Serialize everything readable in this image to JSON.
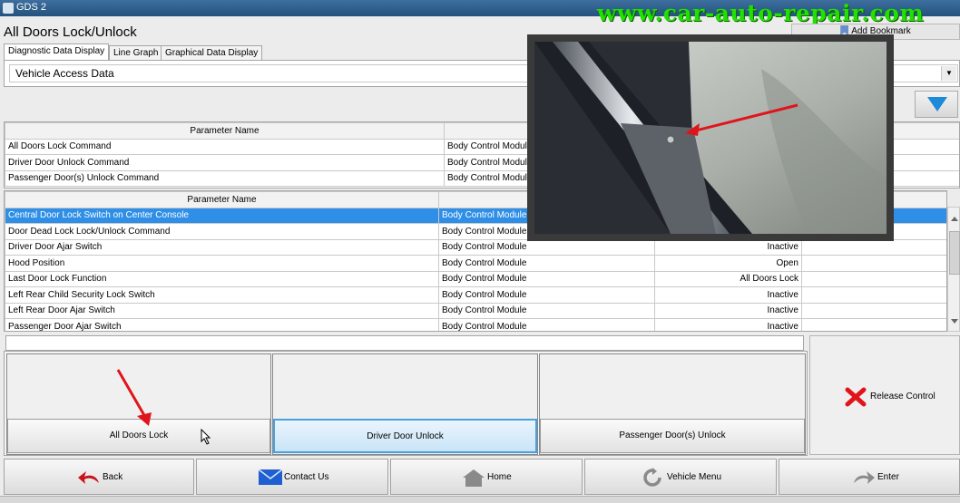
{
  "window": {
    "app_title": "GDS 2"
  },
  "watermark": "www.car-auto-repair.com",
  "page": {
    "title": "All Doors Lock/Unlock",
    "bookmark_label": "Add Bookmark"
  },
  "tabs": [
    {
      "label": "Diagnostic Data Display",
      "active": true
    },
    {
      "label": "Line Graph",
      "active": false
    },
    {
      "label": "Graphical Data Display",
      "active": false
    }
  ],
  "data_selector": {
    "value": "Vehicle Access Data"
  },
  "commands_table": {
    "headers": [
      "Parameter Name",
      "C",
      "",
      "nit"
    ],
    "rows": [
      [
        "All Doors Lock Command",
        "Body Control Module",
        "",
        ""
      ],
      [
        "Driver Door Unlock Command",
        "Body Control Module",
        "",
        ""
      ],
      [
        "Passenger Door(s) Unlock Command",
        "Body Control Module",
        "",
        ""
      ]
    ]
  },
  "params_table": {
    "headers": [
      "Parameter Name",
      "Co",
      "",
      ""
    ],
    "rows": [
      [
        "Central Door Lock Switch on Center Console",
        "Body Control Module",
        "",
        ""
      ],
      [
        "Door Dead Lock Lock/Unlock Command",
        "Body Control Module",
        "",
        ""
      ],
      [
        "Driver Door Ajar Switch",
        "Body Control Module",
        "Inactive",
        ""
      ],
      [
        "Hood Position",
        "Body Control Module",
        "Open",
        ""
      ],
      [
        "Last Door Lock Function",
        "Body Control Module",
        "All Doors Lock",
        ""
      ],
      [
        "Left Rear Child Security Lock Switch",
        "Body Control Module",
        "Inactive",
        ""
      ],
      [
        "Left Rear Door Ajar Switch",
        "Body Control Module",
        "Inactive",
        ""
      ],
      [
        "Passenger Door Ajar Switch",
        "Body Control Module",
        "Inactive",
        ""
      ]
    ],
    "selected_index": 0
  },
  "controls": {
    "all_doors_lock": "All Doors Lock",
    "driver_door_unlock": "Driver Door Unlock",
    "passenger_doors_unlock": "Passenger Door(s) Unlock",
    "release_control": "Release Control"
  },
  "nav": {
    "back": "Back",
    "contact_us": "Contact Us",
    "home": "Home",
    "vehicle_menu": "Vehicle Menu",
    "enter": "Enter"
  },
  "colors": {
    "selection": "#2f8fe6",
    "accent_arrow": "#1c8ad8",
    "annotation": "#e0151b",
    "watermark": "#22e000"
  }
}
